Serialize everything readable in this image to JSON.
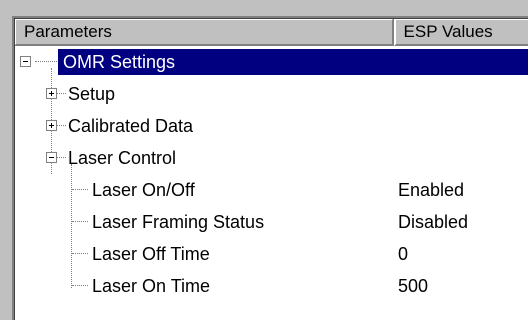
{
  "header": {
    "col_parameters": "Parameters",
    "col_esp_values": "ESP Values"
  },
  "tree": {
    "root": {
      "label": "OMR Settings",
      "expanded": true,
      "selected": true
    },
    "children": [
      {
        "label": "Setup",
        "expanded": false
      },
      {
        "label": "Calibrated Data",
        "expanded": false
      },
      {
        "label": "Laser Control",
        "expanded": true,
        "params": [
          {
            "label": "Laser On/Off",
            "value": "Enabled"
          },
          {
            "label": "Laser Framing Status",
            "value": "Disabled"
          },
          {
            "label": "Laser Off Time",
            "value": "0"
          },
          {
            "label": "Laser On Time",
            "value": "500"
          }
        ]
      }
    ]
  },
  "colors": {
    "selection": "#000080",
    "window_bg": "#c0c0c0",
    "tree_bg": "#ffffff"
  }
}
